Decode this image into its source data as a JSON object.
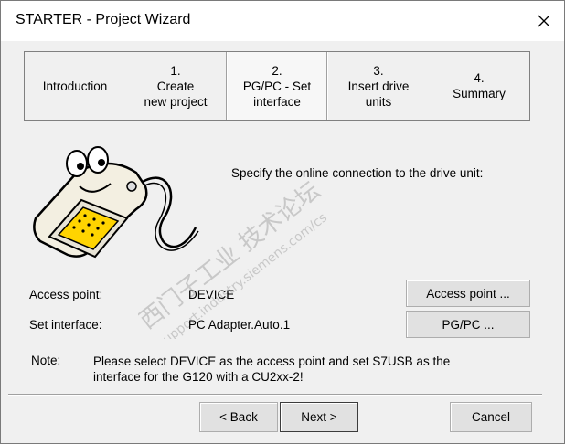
{
  "window": {
    "title": "STARTER - Project Wizard"
  },
  "tabs": [
    {
      "num": "",
      "label1": "Introduction",
      "label2": ""
    },
    {
      "num": "1.",
      "label1": "Create",
      "label2": "new project"
    },
    {
      "num": "2.",
      "label1": "PG/PC - Set",
      "label2": "interface"
    },
    {
      "num": "3.",
      "label1": "Insert drive",
      "label2": "units"
    },
    {
      "num": "4.",
      "label1": "Summary",
      "label2": ""
    }
  ],
  "prompt": "Specify the online connection to the drive unit:",
  "fields": {
    "access_point_label": "Access point:",
    "access_point_value": "DEVICE",
    "set_interface_label": "Set interface:",
    "set_interface_value": "PC Adapter.Auto.1"
  },
  "buttons": {
    "access_point": "Access point ...",
    "pgpc": "PG/PC ...",
    "back": "< Back",
    "next": "Next >",
    "cancel": "Cancel"
  },
  "note": {
    "label": "Note:",
    "text": "Please select DEVICE as the access point and set S7USB as the interface for the G120 with a CU2xx-2!"
  },
  "watermark": {
    "line1": "西门子工业  技术论坛",
    "line2": "support.industry.siemens.com/cs"
  },
  "icons": {
    "close": "close-icon",
    "mascot": "serial-cable-mascot-icon"
  }
}
